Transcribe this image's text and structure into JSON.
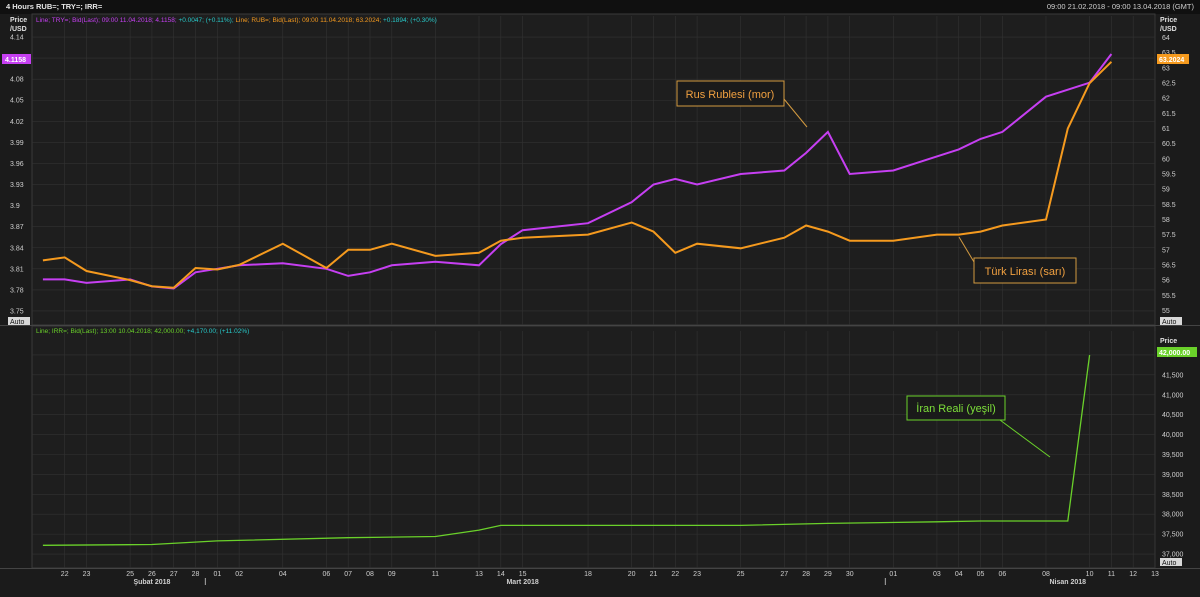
{
  "header": {
    "title": "4 Hours RUB=; TRY=; IRR=",
    "range": "09:00 21.02.2018 - 09:00 13.04.2018 (GMT)"
  },
  "panel1": {
    "legend": {
      "try": "Line; TRY=; Bid(Last); 09:00 11.04.2018; 4.1158;",
      "try_change": "+0.0047; (+0.11%);",
      "rub": "Line; RUB=; Bid(Last); 09:00 11.04.2018; 63.2024;",
      "rub_change": "+0.1894; (+0.30%)"
    },
    "left_axis_title": [
      "Price",
      "/USD"
    ],
    "right_axis_title": [
      "Price",
      "/USD"
    ],
    "left_ticks": [
      "4.14",
      "4.11",
      "4.08",
      "4.05",
      "4.02",
      "3.99",
      "3.96",
      "3.93",
      "3.9",
      "3.87",
      "3.84",
      "3.81",
      "3.78",
      "3.75"
    ],
    "right_ticks": [
      "64",
      "63.5",
      "63",
      "62.5",
      "62",
      "61.5",
      "61",
      "60.5",
      "60",
      "59.5",
      "59",
      "58.5",
      "58",
      "57.5",
      "57",
      "56.5",
      "56",
      "55.5",
      "55"
    ],
    "left_current": "4.1158",
    "right_current": "63.2024",
    "auto_label": "Auto",
    "auto_label_right": "Auto",
    "annotations": {
      "rub": "Rus Rublesi (mor)",
      "try": "Türk Lirası (sarı)"
    }
  },
  "panel2": {
    "legend": "Line; IRR=; Bid(Last); 13:00 10.04.2018; 42,000.00;",
    "legend_change": "+4,170.00; (+11.02%)",
    "axis_title": "Price",
    "ticks": [
      "42,000.00",
      "41,500",
      "41,000",
      "40,500",
      "40,000",
      "39,500",
      "39,000",
      "38,500",
      "38,000",
      "37,500",
      "37,000"
    ],
    "current": "42,000.00",
    "auto_label": "Auto",
    "annotation": "İran Reali (yeşil)"
  },
  "xaxis": {
    "days": [
      "22",
      "23",
      "25",
      "26",
      "27",
      "28",
      "01",
      "02",
      "04",
      "06",
      "07",
      "08",
      "09",
      "11",
      "13",
      "14",
      "15",
      "18",
      "20",
      "21",
      "22",
      "23",
      "25",
      "27",
      "28",
      "29",
      "30",
      "01",
      "03",
      "04",
      "05",
      "06",
      "08",
      "10",
      "11",
      "12",
      "13"
    ],
    "months": [
      "Şubat 2018",
      "Mart 2018",
      "Nisan 2018"
    ]
  },
  "colors": {
    "rub": "#c63ff2",
    "try": "#f59a1e",
    "irr": "#6ad12a",
    "background": "#1b1b1b",
    "grid": "#333333"
  },
  "chart_data": [
    {
      "type": "line",
      "series": [
        {
          "ticker": "TRY=",
          "axis": "left",
          "x": [
            "2018-02-21",
            "2018-02-22",
            "2018-02-23",
            "2018-02-25",
            "2018-02-26",
            "2018-02-27",
            "2018-02-28",
            "2018-03-01",
            "2018-03-02",
            "2018-03-04",
            "2018-03-06",
            "2018-03-07",
            "2018-03-08",
            "2018-03-09",
            "2018-03-11",
            "2018-03-13",
            "2018-03-14",
            "2018-03-15",
            "2018-03-18",
            "2018-03-20",
            "2018-03-21",
            "2018-03-22",
            "2018-03-23",
            "2018-03-25",
            "2018-03-27",
            "2018-03-28",
            "2018-03-29",
            "2018-03-30",
            "2018-04-01",
            "2018-04-03",
            "2018-04-04",
            "2018-04-05",
            "2018-04-06",
            "2018-04-08",
            "2018-04-09",
            "2018-04-10",
            "2018-04-11"
          ],
          "values": [
            3.795,
            3.795,
            3.79,
            3.795,
            3.785,
            3.782,
            3.805,
            3.81,
            3.815,
            3.818,
            3.81,
            3.8,
            3.805,
            3.815,
            3.82,
            3.815,
            3.845,
            3.865,
            3.875,
            3.905,
            3.93,
            3.938,
            3.93,
            3.945,
            3.95,
            3.975,
            4.005,
            3.945,
            3.95,
            3.97,
            3.98,
            3.995,
            4.005,
            4.055,
            4.065,
            4.075,
            4.1158
          ]
        },
        {
          "ticker": "RUB=",
          "axis": "right",
          "x": [
            "2018-02-21",
            "2018-02-22",
            "2018-02-23",
            "2018-02-25",
            "2018-02-26",
            "2018-02-27",
            "2018-02-28",
            "2018-03-01",
            "2018-03-02",
            "2018-03-04",
            "2018-03-06",
            "2018-03-07",
            "2018-03-08",
            "2018-03-09",
            "2018-03-11",
            "2018-03-13",
            "2018-03-14",
            "2018-03-15",
            "2018-03-18",
            "2018-03-20",
            "2018-03-21",
            "2018-03-22",
            "2018-03-23",
            "2018-03-25",
            "2018-03-27",
            "2018-03-28",
            "2018-03-29",
            "2018-03-30",
            "2018-04-01",
            "2018-04-03",
            "2018-04-04",
            "2018-04-05",
            "2018-04-06",
            "2018-04-08",
            "2018-04-09",
            "2018-04-10",
            "2018-04-11"
          ],
          "values": [
            56.65,
            56.75,
            56.3,
            56.0,
            55.8,
            55.75,
            56.4,
            56.35,
            56.5,
            57.2,
            56.4,
            57.0,
            57.0,
            57.2,
            56.8,
            56.9,
            57.3,
            57.4,
            57.5,
            57.9,
            57.6,
            56.9,
            57.2,
            57.05,
            57.4,
            57.8,
            57.6,
            57.3,
            57.3,
            57.5,
            57.5,
            57.6,
            57.8,
            58.0,
            61.0,
            62.5,
            63.2024
          ]
        }
      ],
      "ylim_left": [
        3.74,
        4.15
      ],
      "ylim_right": [
        54.75,
        64.25
      ],
      "grid": true
    },
    {
      "type": "line",
      "series": [
        {
          "ticker": "IRR=",
          "x": [
            "2018-02-21",
            "2018-02-26",
            "2018-03-01",
            "2018-03-07",
            "2018-03-11",
            "2018-03-13",
            "2018-03-14",
            "2018-03-25",
            "2018-03-29",
            "2018-04-03",
            "2018-04-05",
            "2018-04-09",
            "2018-04-10"
          ],
          "values": [
            37220,
            37240,
            37330,
            37410,
            37440,
            37600,
            37720,
            37720,
            37770,
            37810,
            37830,
            37830,
            42000
          ]
        }
      ],
      "ylim": [
        36850,
        42250
      ],
      "grid": true
    }
  ]
}
